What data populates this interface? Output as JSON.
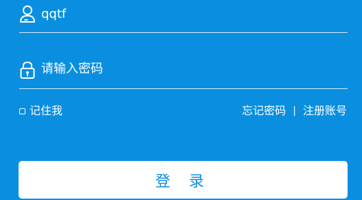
{
  "form": {
    "username": {
      "icon": "user-icon",
      "value": "qqtf"
    },
    "password": {
      "icon": "lock-icon",
      "placeholder": "请输入密码"
    },
    "remember_label": "记住我",
    "forgot_label": "忘记密码",
    "separator": "|",
    "register_label": "注册账号",
    "login_label": "登 录"
  },
  "colors": {
    "background": "#0a8fe0",
    "button": "#ffffff",
    "button_text": "#0a8fe0"
  }
}
